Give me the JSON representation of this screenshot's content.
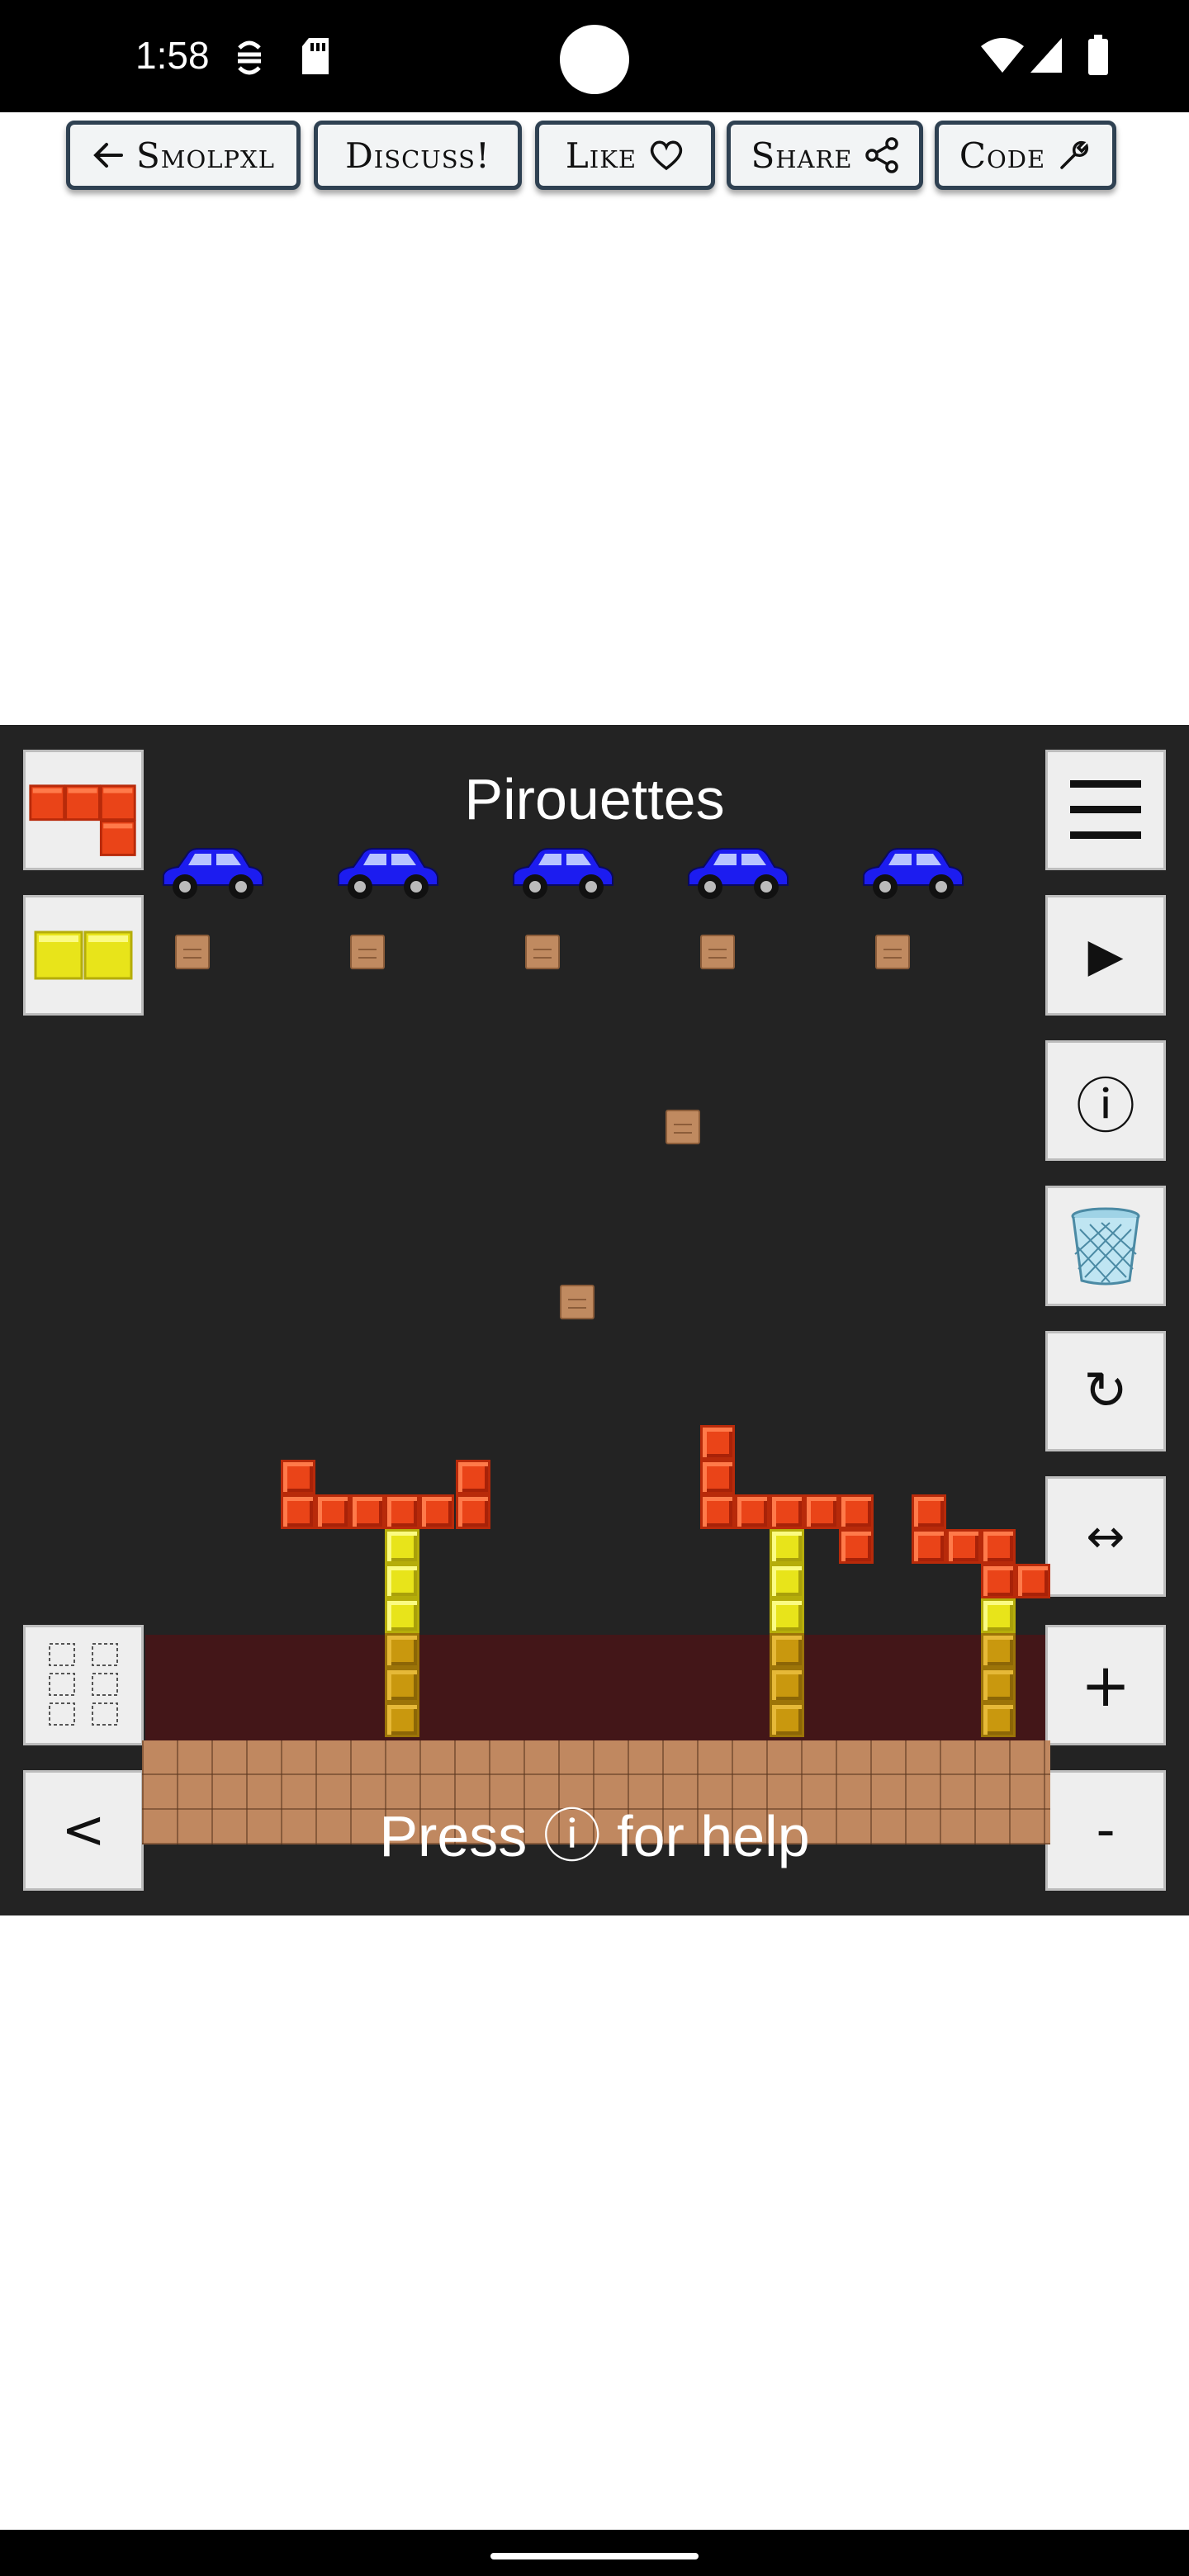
{
  "status_bar": {
    "time": "1:58",
    "icons": [
      "sync-icon",
      "sd-card-icon",
      "wifi-icon",
      "signal-icon",
      "battery-icon"
    ]
  },
  "toolbar": {
    "back_label": "Smolpxl",
    "discuss_label": "Discuss!",
    "like_label": "Like",
    "share_label": "Share",
    "code_label": "Code"
  },
  "game": {
    "title": "Pirouettes",
    "help_text": "Press ⓘ for help",
    "colors": {
      "panel_bg": "#232323",
      "lava": "#431618",
      "ground": "#c08860",
      "red_block": "#ea4418",
      "yellow_block": "#e8e41a",
      "car": "#1c1cf0"
    },
    "left_palette": {
      "piece_1": "red-l-piece-icon",
      "piece_2": "yellow-domino-icon",
      "select_grid": "grid-select-icon",
      "prev_label": "<"
    },
    "right_controls": {
      "menu": "hamburger-menu-icon",
      "play": "▶",
      "info": "ⓘ",
      "delete": "wastebasket-icon",
      "rotate": "↻",
      "flip": "↔",
      "zoom_in": "+",
      "zoom_out": "-"
    },
    "cars_count": 5
  }
}
